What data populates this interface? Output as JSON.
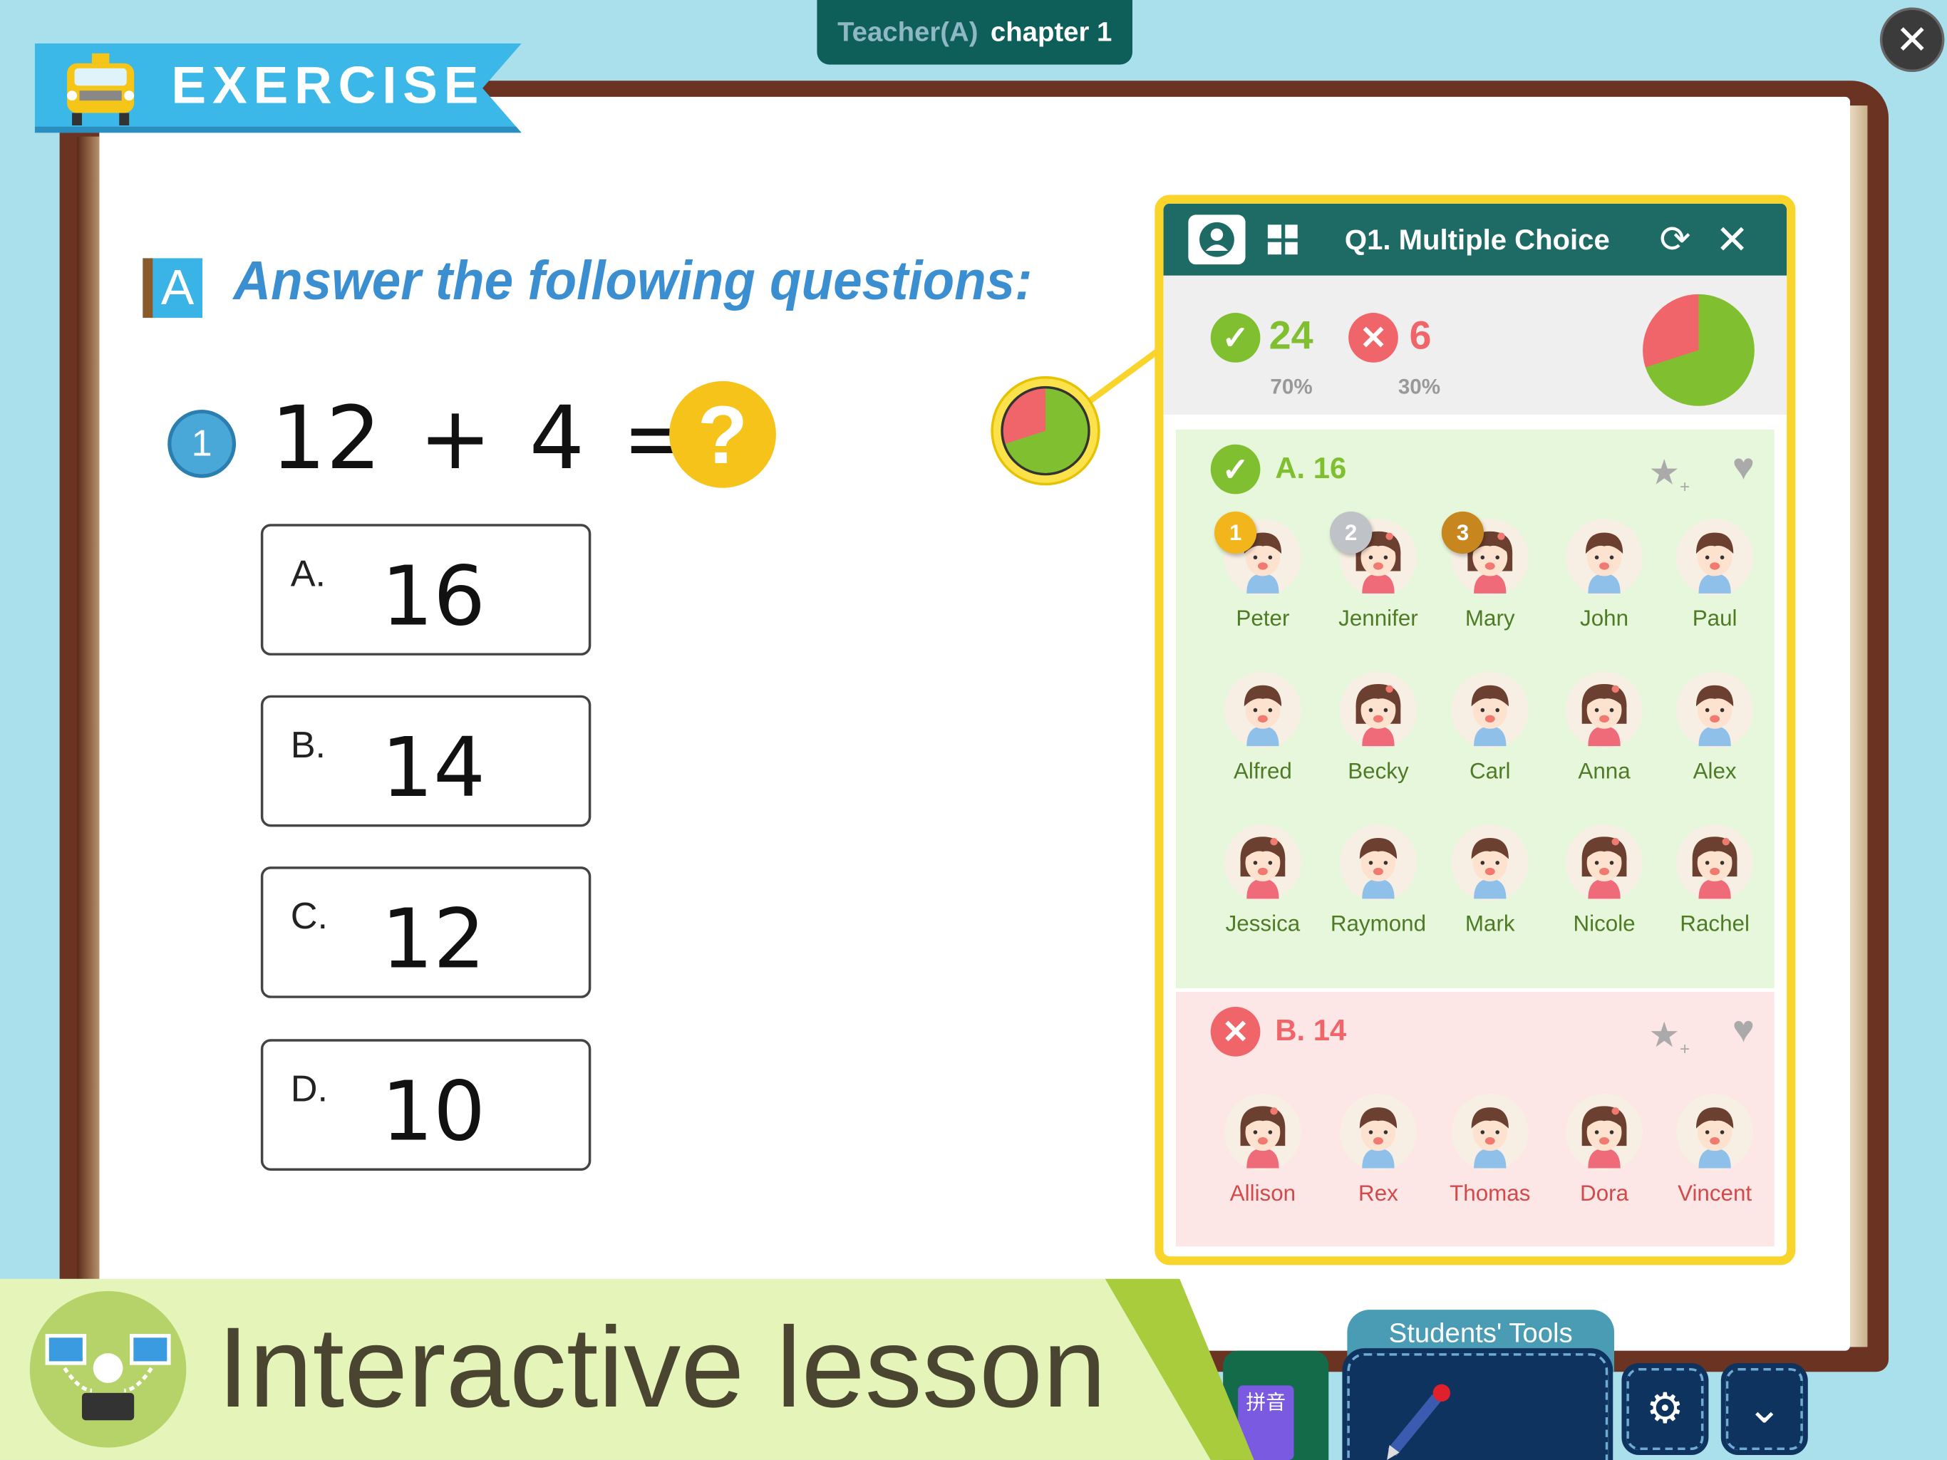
{
  "header": {
    "teacher": "Teacher(A)",
    "chapter": "chapter 1"
  },
  "banner": {
    "label": "EXERCISE"
  },
  "exercise": {
    "section_badge": "A",
    "heading": "Answer the following questions:",
    "question_number": "1",
    "equation": "12 + 4 =",
    "unknown": "?",
    "options": [
      {
        "label": "A.",
        "value": "16"
      },
      {
        "label": "B.",
        "value": "14"
      },
      {
        "label": "C.",
        "value": "12"
      },
      {
        "label": "D.",
        "value": "10"
      }
    ]
  },
  "panel": {
    "title": "Q1. Multiple Choice",
    "correct_count": "24",
    "correct_percent": "70%",
    "wrong_count": "6",
    "wrong_percent": "30%",
    "correct_fraction": 0.7,
    "colors": {
      "correct": "#80c030",
      "wrong": "#f0656a",
      "header": "#1e6b65",
      "border": "#f9d52c"
    },
    "correct_answer": {
      "label": "A. 16",
      "students": [
        {
          "name": "Peter",
          "gender": "boy",
          "medal": "1"
        },
        {
          "name": "Jennifer",
          "gender": "girl",
          "medal": "2"
        },
        {
          "name": "Mary",
          "gender": "girl",
          "medal": "3"
        },
        {
          "name": "John",
          "gender": "boy"
        },
        {
          "name": "Paul",
          "gender": "boy"
        },
        {
          "name": "Alfred",
          "gender": "boy"
        },
        {
          "name": "Becky",
          "gender": "girl"
        },
        {
          "name": "Carl",
          "gender": "boy"
        },
        {
          "name": "Anna",
          "gender": "girl"
        },
        {
          "name": "Alex",
          "gender": "boy"
        },
        {
          "name": "Jessica",
          "gender": "girl"
        },
        {
          "name": "Raymond",
          "gender": "boy"
        },
        {
          "name": "Mark",
          "gender": "boy"
        },
        {
          "name": "Nicole",
          "gender": "girl"
        },
        {
          "name": "Rachel",
          "gender": "girl"
        }
      ]
    },
    "wrong_answer": {
      "label": "B. 14",
      "students": [
        {
          "name": "Allison",
          "gender": "girl"
        },
        {
          "name": "Rex",
          "gender": "boy"
        },
        {
          "name": "Thomas",
          "gender": "boy"
        },
        {
          "name": "Dora",
          "gender": "girl"
        },
        {
          "name": "Vincent",
          "gender": "boy"
        }
      ]
    }
  },
  "footer": {
    "title": "Interactive lesson",
    "tools_label": "Students' Tools",
    "pinyin_label": "拼音"
  }
}
